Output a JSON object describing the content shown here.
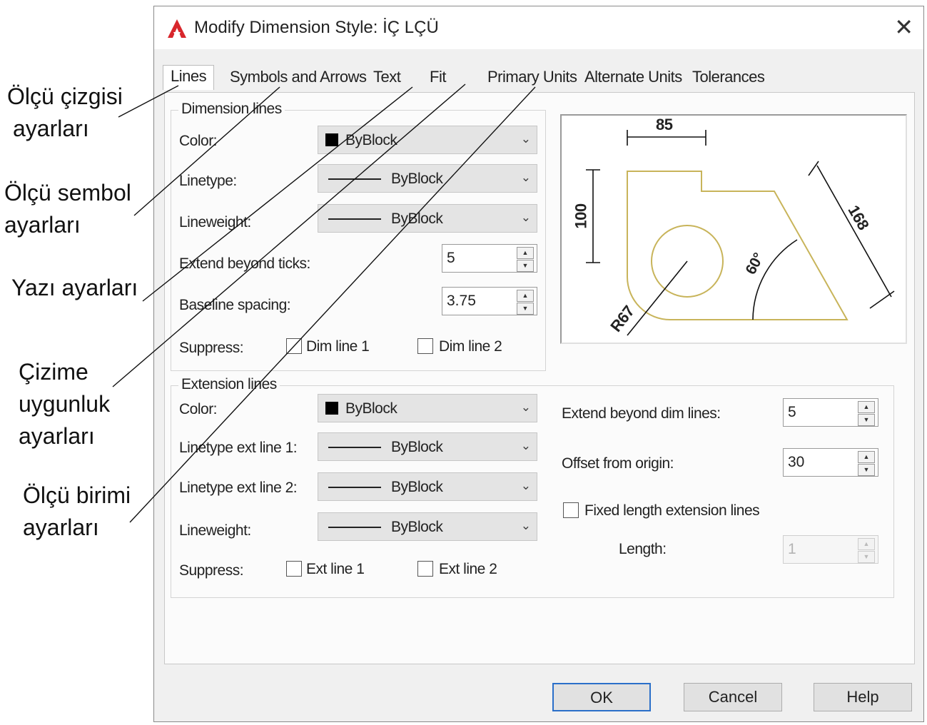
{
  "annotations": [
    {
      "line1": "Ölçü çizgisi",
      "line2": "ayarları"
    },
    {
      "line1": "Ölçü sembol",
      "line2": "ayarları"
    },
    {
      "line1": "Yazı ayarları"
    },
    {
      "line1": "Çizime",
      "line2": "uygunluk",
      "line3": "ayarları"
    },
    {
      "line1": "Ölçü birimi",
      "line2": "ayarları"
    }
  ],
  "dialog": {
    "title": "Modify Dimension Style: İÇ LÇÜ",
    "close_glyph": "✕"
  },
  "tabs": [
    {
      "label": "Lines",
      "active": true
    },
    {
      "label": "Symbols and Arrows"
    },
    {
      "label": "Text"
    },
    {
      "label": "Fit"
    },
    {
      "label": "Primary Units"
    },
    {
      "label": "Alternate Units"
    },
    {
      "label": "Tolerances"
    }
  ],
  "dimension_lines": {
    "title": "Dimension lines",
    "color_label": "Color:",
    "color_value": "ByBlock",
    "linetype_label": "Linetype:",
    "linetype_value": "ByBlock",
    "lineweight_label": "Lineweight:",
    "lineweight_value": "ByBlock",
    "extend_label": "Extend beyond ticks:",
    "extend_value": "5",
    "baseline_label": "Baseline spacing:",
    "baseline_value": "3.75",
    "suppress_label": "Suppress:",
    "dim_line_1": "Dim line 1",
    "dim_line_2": "Dim line 2"
  },
  "extension_lines": {
    "title": "Extension lines",
    "color_label": "Color:",
    "color_value": "ByBlock",
    "lt1_label": "Linetype ext line 1:",
    "lt1_value": "ByBlock",
    "lt2_label": "Linetype ext line 2:",
    "lt2_value": "ByBlock",
    "lineweight_label": "Lineweight:",
    "lineweight_value": "ByBlock",
    "suppress_label": "Suppress:",
    "ext_line_1": "Ext line 1",
    "ext_line_2": "Ext line 2",
    "extend_dim_label": "Extend beyond dim lines:",
    "extend_dim_value": "5",
    "offset_label": "Offset from origin:",
    "offset_value": "30",
    "fixed_label": "Fixed length extension lines",
    "length_label": "Length:",
    "length_value": "1"
  },
  "preview": {
    "dim_top": "85",
    "dim_left": "100",
    "dim_diag": "168",
    "dim_angle": "60°",
    "dim_radius": "R67"
  },
  "buttons": {
    "ok": "OK",
    "cancel": "Cancel",
    "help": "Help"
  },
  "colors": {
    "shape_stroke": "#c8b45a",
    "default_button_border": "#2a6fc9",
    "app_icon": "#d8262c"
  }
}
